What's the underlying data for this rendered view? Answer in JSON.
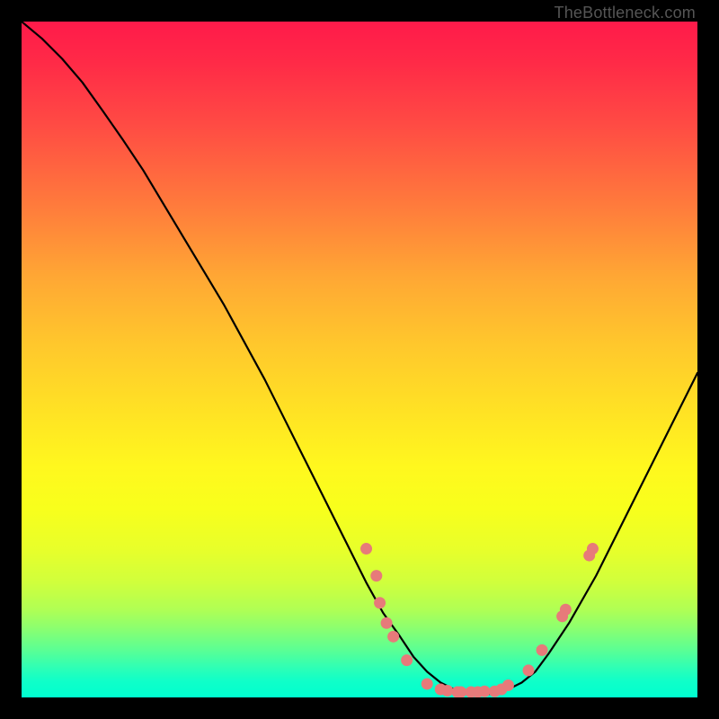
{
  "watermark": "TheBottleneck.com",
  "colors": {
    "curve": "#000000",
    "dot_fill": "#e77a7a",
    "dot_stroke": "#d15c5c",
    "background_black": "#000000"
  },
  "chart_data": {
    "type": "line",
    "title": "",
    "xlabel": "",
    "ylabel": "",
    "xlim": [
      0,
      100
    ],
    "ylim": [
      0,
      100
    ],
    "grid": false,
    "series": [
      {
        "name": "curve",
        "x": [
          0,
          3,
          6,
          9,
          12,
          15,
          18,
          21,
          24,
          27,
          30,
          33,
          36,
          39,
          42,
          45,
          48,
          51,
          53.5,
          56,
          58,
          60,
          62,
          64,
          66,
          68,
          70,
          72,
          74,
          76,
          78,
          81,
          85,
          88,
          91,
          94,
          97,
          100
        ],
        "y": [
          100,
          97.5,
          94.5,
          91,
          86.8,
          82.5,
          78,
          73,
          68,
          63,
          58,
          52.5,
          47,
          41,
          35,
          29,
          23,
          17,
          12.5,
          9,
          6,
          3.8,
          2.2,
          1.2,
          0.6,
          0.4,
          0.6,
          1.2,
          2.2,
          3.8,
          6.5,
          11,
          18,
          24,
          30,
          36,
          42,
          48
        ]
      }
    ],
    "dots": [
      {
        "x": 51,
        "y": 22
      },
      {
        "x": 52.5,
        "y": 18
      },
      {
        "x": 53,
        "y": 14
      },
      {
        "x": 54,
        "y": 11
      },
      {
        "x": 55,
        "y": 9
      },
      {
        "x": 57,
        "y": 5.5
      },
      {
        "x": 60,
        "y": 2
      },
      {
        "x": 62,
        "y": 1.2
      },
      {
        "x": 63,
        "y": 1
      },
      {
        "x": 64.5,
        "y": 0.8
      },
      {
        "x": 65,
        "y": 0.8
      },
      {
        "x": 66.5,
        "y": 0.8
      },
      {
        "x": 67.5,
        "y": 0.8
      },
      {
        "x": 68.5,
        "y": 0.9
      },
      {
        "x": 70,
        "y": 0.9
      },
      {
        "x": 71,
        "y": 1.2
      },
      {
        "x": 72,
        "y": 1.8
      },
      {
        "x": 75,
        "y": 4
      },
      {
        "x": 77,
        "y": 7
      },
      {
        "x": 80,
        "y": 12
      },
      {
        "x": 80.5,
        "y": 13
      },
      {
        "x": 84,
        "y": 21
      },
      {
        "x": 84.5,
        "y": 22
      }
    ]
  }
}
